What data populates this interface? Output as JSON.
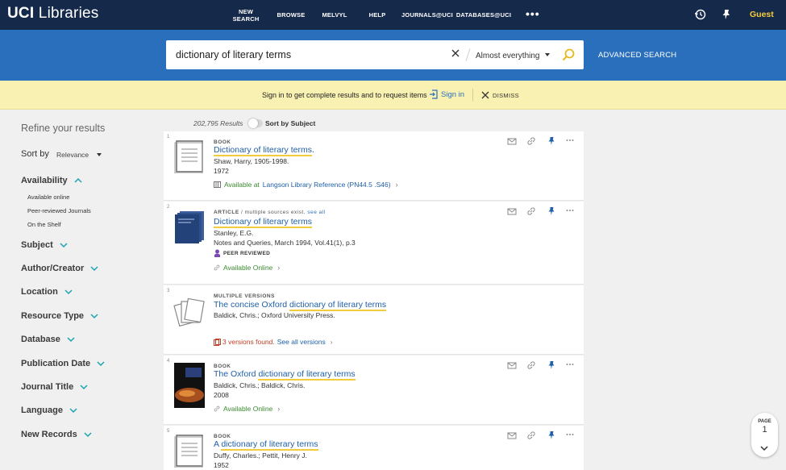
{
  "header": {
    "logo_bold": "UCI",
    "logo_rest": " Libraries",
    "nav": [
      {
        "label": "NEW\nSEARCH"
      },
      {
        "label": "BROWSE"
      },
      {
        "label": "MELVYL"
      },
      {
        "label": "HELP"
      },
      {
        "label": "JOURNALS@UCI"
      },
      {
        "label": "DATABASES@UCI"
      }
    ],
    "more": "•••",
    "user": "Guest",
    "icons": [
      "history-icon",
      "pin-icon"
    ]
  },
  "search": {
    "query": "dictionary of literary terms",
    "scope": "Almost everything",
    "advanced": "ADVANCED SEARCH"
  },
  "signin_bar": {
    "message": "Sign in to get complete results and to request items",
    "signin": "Sign in",
    "dismiss": "DISMISS"
  },
  "sidebar": {
    "title": "Refine your results",
    "sort_label": "Sort by",
    "sort_value": "Relevance",
    "availability": "Availability",
    "availability_items": [
      "Available online",
      "Peer-reviewed Journals",
      "On the Shelf"
    ],
    "facets": [
      "Subject",
      "Author/Creator",
      "Location",
      "Resource Type",
      "Database",
      "Publication Date",
      "Journal Title",
      "Language",
      "New Records"
    ]
  },
  "results_meta": {
    "count": "202,795 Results",
    "sort_by_subject": "Sort by Subject"
  },
  "results": [
    {
      "num": "1",
      "type": "BOOK",
      "title_pre": "",
      "title_hl": "Dictionary of literary terms",
      "title_post": ".",
      "lines": [
        "Shaw, Harry, 1905-1998.",
        "1972"
      ],
      "availability": "Available at",
      "location": "Langson Library Reference (PN44.5 .S46)"
    },
    {
      "num": "2",
      "type": "ARTICLE",
      "type_note": "/ multiple sources exist.",
      "see_all": "see all",
      "title_pre": "",
      "title_hl": "Dictionary of literary terms",
      "title_post": "",
      "lines": [
        "Stanley, E.G.",
        "Notes and Queries, March 1994, Vol.41(1), p.3"
      ],
      "peer": "PEER REVIEWED",
      "availability": "Available Online"
    },
    {
      "num": "3",
      "type": "MULTIPLE VERSIONS",
      "title_pre": "The concise Oxford ",
      "title_hl": "dictionary of literary terms",
      "title_post": "",
      "lines": [
        "Baldick, Chris.; Oxford University Press."
      ],
      "versions": "3 versions found.",
      "see_versions": "See all versions"
    },
    {
      "num": "4",
      "type": "BOOK",
      "title_pre": "The Oxford ",
      "title_hl": "dictionary of literary terms",
      "title_post": "",
      "lines": [
        "Baldick, Chris.; Baldick, Chris.",
        "2008"
      ],
      "availability": "Available Online"
    },
    {
      "num": "5",
      "type": "BOOK",
      "title_pre": "A ",
      "title_hl": "dictionary of literary terms",
      "title_post": "",
      "lines": [
        "Duffy, Charles.; Pettit, Henry J.",
        "1952"
      ]
    }
  ],
  "page": {
    "label": "PAGE",
    "number": "1"
  },
  "colors": {
    "topbar": "#15294b",
    "searchband": "#2a6fbc",
    "signbar": "#f8f1b2",
    "accent": "#f7cd3a",
    "link": "#1f5fa8",
    "available": "#3a8a2e",
    "chevron": "#1aa3b0"
  }
}
